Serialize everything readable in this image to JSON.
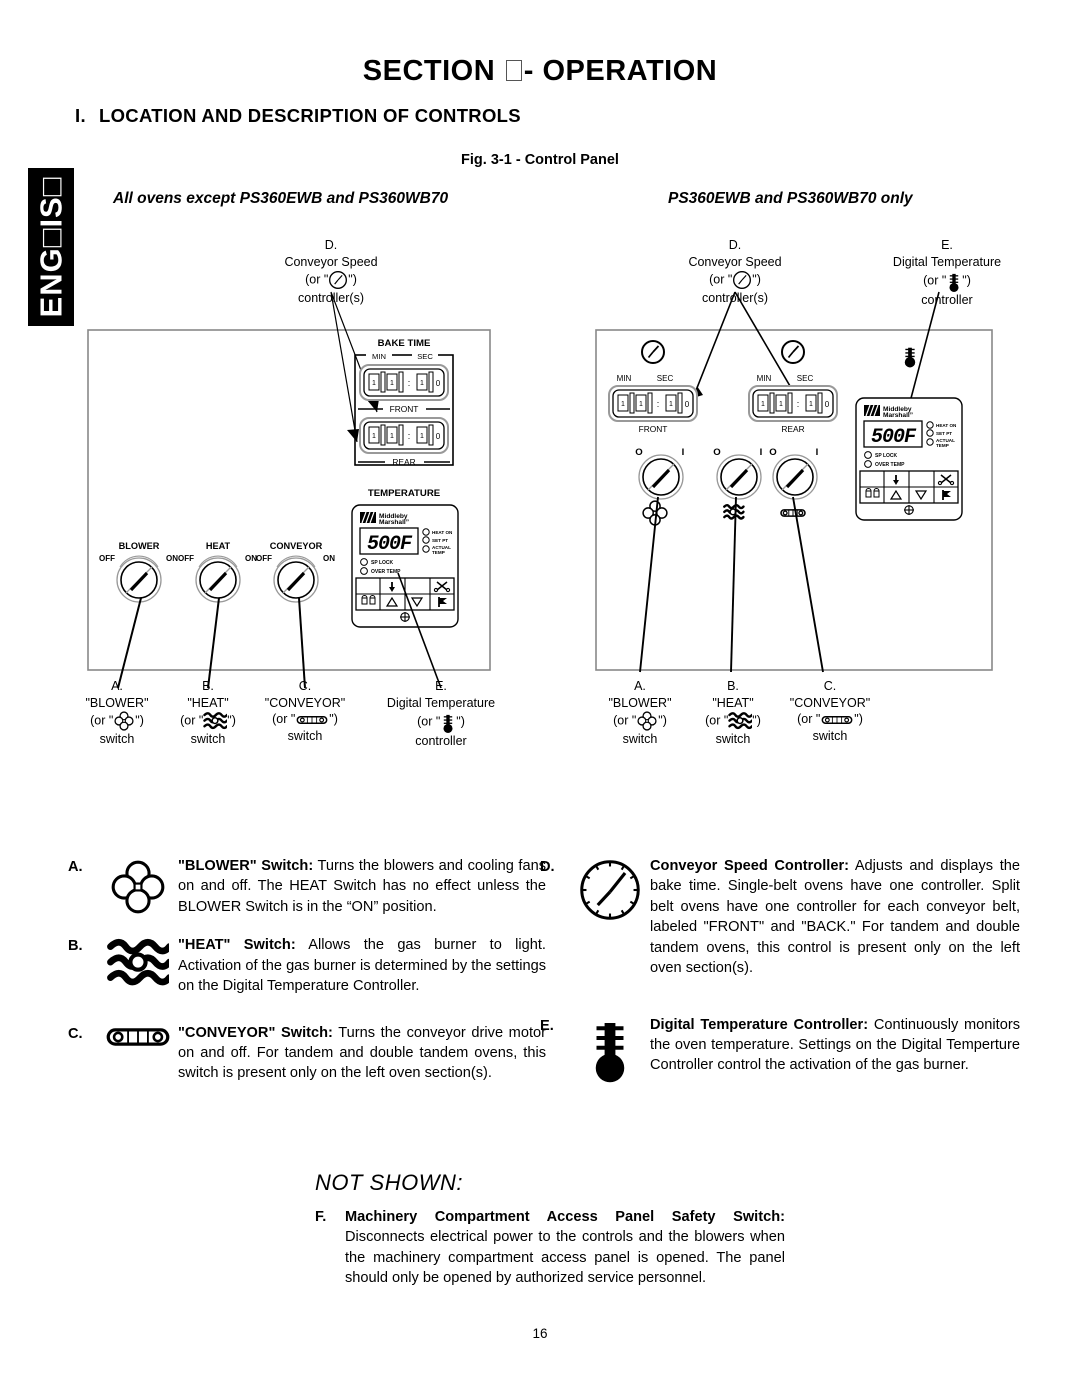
{
  "document": {
    "section_title_pre": "SECTION ",
    "section_title_post": "- OPERATION",
    "sub_title_numeral": "I.",
    "sub_title": "LOCATION AND DESCRIPTION OF CONTROLS",
    "figure_caption": "Fig. 3-1 - Control Panel",
    "page_number": "16",
    "language_tab": "ENG□IS□"
  },
  "panels": {
    "left_heading": "All ovens except PS360EWB and PS360WB70",
    "right_heading": "PS360EWB and PS360WB70 only"
  },
  "left_panel": {
    "callout_d": {
      "letter": "D.",
      "line1": "Conveyor Speed",
      "line2_pre": "(or \"",
      "line2_post": "\")",
      "line3": "controller(s)"
    },
    "bake_time_title": "BAKE TIME",
    "labels": {
      "min": "MIN",
      "sec": "SEC",
      "front": "FRONT",
      "rear": "REAR",
      "temperature": "TEMPERATURE"
    },
    "bake_time_front_digits": [
      "1",
      "1",
      "1",
      "0"
    ],
    "bake_time_rear_digits": [
      "1",
      "1",
      "1",
      "0"
    ],
    "switches": [
      {
        "title": "BLOWER",
        "off": "OFF",
        "on": "ON"
      },
      {
        "title": "HEAT",
        "off": "OFF",
        "on": "ON"
      },
      {
        "title": "CONVEYOR",
        "off": "OFF",
        "on": "ON"
      }
    ],
    "bottom_callouts": [
      {
        "letter": "A.",
        "name": "\"BLOWER\"",
        "or_pre": "(or \"",
        "or_post": "\")",
        "tail": "switch",
        "icon": "fan-icon"
      },
      {
        "letter": "B.",
        "name": "\"HEAT\"",
        "or_pre": "(or \"",
        "or_post": "\")",
        "tail": "switch",
        "icon": "heat-icon"
      },
      {
        "letter": "C.",
        "name": "\"CONVEYOR\"",
        "or_pre": "(or \"",
        "or_post": "\")",
        "tail": "switch",
        "icon": "conveyor-icon"
      },
      {
        "letter": "E.",
        "name": "Digital Temperature",
        "or_pre": "(or \"",
        "or_post": "\")",
        "tail": "controller",
        "icon": "thermometer-icon"
      }
    ]
  },
  "right_panel": {
    "callout_d": {
      "letter": "D.",
      "line1": "Conveyor Speed",
      "line2_pre": "(or \"",
      "line2_post": "\")",
      "line3": "controller(s)"
    },
    "callout_e": {
      "letter": "E.",
      "line1": "Digital Temperature",
      "line2_pre": "(or \"",
      "line2_post": "\")",
      "line3": "controller"
    },
    "labels": {
      "min": "MIN",
      "sec": "SEC",
      "front": "FRONT",
      "rear": "REAR",
      "o": "O",
      "i": "I"
    },
    "bake_time_front_digits": [
      "1",
      "1",
      "1",
      "0"
    ],
    "bake_time_rear_digits": [
      "1",
      "1",
      "1",
      "0"
    ],
    "bottom_callouts": [
      {
        "letter": "A.",
        "name": "\"BLOWER\"",
        "or_pre": "(or \"",
        "or_post": "\")",
        "tail": "switch",
        "icon": "fan-icon"
      },
      {
        "letter": "B.",
        "name": "\"HEAT\"",
        "or_pre": "(or \"",
        "or_post": "\")",
        "tail": "switch",
        "icon": "heat-icon"
      },
      {
        "letter": "C.",
        "name": "\"CONVEYOR\"",
        "or_pre": "(or \"",
        "or_post": "\")",
        "tail": "switch",
        "icon": "conveyor-icon"
      }
    ]
  },
  "temperature_controller": {
    "brand_line1": "Middleby",
    "brand_line2": "Marshall",
    "display_value": "500F",
    "indicators": [
      "HEAT ON",
      "SET PT",
      "ACTUAL TEMP"
    ],
    "status_lamps": [
      "SP LOCK",
      "OVER TEMP"
    ],
    "keypad_row1": [
      "",
      "down-arrow-solid-icon",
      "",
      "scissors-icon"
    ],
    "keypad_row2": [
      "lock-icon",
      "triangle-up-icon",
      "triangle-down-icon",
      "flag-icon"
    ],
    "bottom_symbol": "target-cross-icon"
  },
  "descriptions": {
    "left": [
      {
        "letter": "A.",
        "icon": "fan-icon",
        "title": "\"BLOWER\" Switch:",
        "body": " Turns the blowers and cooling fans on and off. The HEAT Switch has no effect unless the BLOWER Switch is in the “ON” position."
      },
      {
        "letter": "B.",
        "icon": "heat-icon",
        "title": "\"HEAT\" Switch:",
        "body": " Allows the gas burner to light. Activation of the gas burner is determined by the settings on the Digital Temperature Controller."
      },
      {
        "letter": "C.",
        "icon": "conveyor-icon",
        "title": "\"CONVEYOR\" Switch:",
        "body": " Turns the conveyor drive motor on and off. For tandem and double tandem ovens, this switch is present only on the left oven section(s)."
      }
    ],
    "right": [
      {
        "letter": "D.",
        "icon": "clock-icon",
        "title": "Conveyor Speed Controller:",
        "body": " Adjusts and displays the bake time. Single-belt ovens have one controller. Split belt ovens have one controller for each conveyor belt, labeled \"FRONT\" and \"BACK.\" For tandem and double tandem ovens, this control is present only on the left oven section(s)."
      },
      {
        "letter": "E.",
        "icon": "thermometer-icon",
        "title": "Digital Temperature Controller:",
        "body": " Continuously monitors the oven temperature. Settings on the Digital Temperture Controller control the activation of the gas burner."
      }
    ]
  },
  "not_shown": {
    "title": "NOT SHOWN:",
    "letter": "F.",
    "item_title": "Machinery Compartment Access Panel Safety Switch:",
    "item_body": " Disconnects electrical power to the controls and the blowers when the machinery compartment access panel is opened. The panel should only be opened by authorized service personnel."
  },
  "colors": {
    "ink": "#000000",
    "paper": "#ffffff",
    "panel_border": "#777777"
  }
}
